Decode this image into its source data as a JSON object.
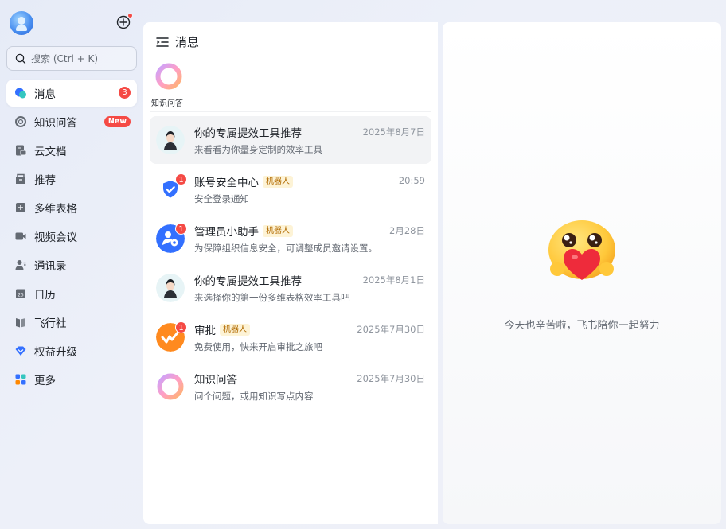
{
  "sidebar": {
    "search_placeholder": "搜索 (Ctrl + K)",
    "items": [
      {
        "label": "消息",
        "icon": "chat-bubble-icon",
        "badge": "3",
        "active": true
      },
      {
        "label": "知识问答",
        "icon": "knowledge-qa-icon",
        "new_badge": "New"
      },
      {
        "label": "云文档",
        "icon": "cloud-docs-icon"
      },
      {
        "label": "推荐",
        "icon": "recommend-icon"
      },
      {
        "label": "多维表格",
        "icon": "multi-table-icon"
      },
      {
        "label": "视频会议",
        "icon": "video-meeting-icon"
      },
      {
        "label": "通讯录",
        "icon": "contacts-icon"
      },
      {
        "label": "日历",
        "icon": "calendar-icon"
      },
      {
        "label": "飞行社",
        "icon": "flight-club-icon"
      },
      {
        "label": "权益升级",
        "icon": "upgrade-diamond-icon"
      },
      {
        "label": "更多",
        "icon": "more-apps-icon"
      }
    ]
  },
  "list": {
    "title": "消息",
    "pinned_label": "知识问答",
    "conversations": [
      {
        "name": "你的专属提效工具推荐",
        "time": "2025年8月7日",
        "preview": "来看看为你量身定制的效率工具",
        "active": true
      },
      {
        "name": "账号安全中心",
        "tag": "机器人",
        "time": "20:59",
        "preview": "安全登录通知",
        "unread": "1"
      },
      {
        "name": "管理员小助手",
        "tag": "机器人",
        "time": "2月28日",
        "preview": "为保障组织信息安全，可调整成员邀请设置。",
        "unread": "1"
      },
      {
        "name": "你的专属提效工具推荐",
        "time": "2025年8月1日",
        "preview": "来选择你的第一份多维表格效率工具吧"
      },
      {
        "name": "审批",
        "tag": "机器人",
        "time": "2025年7月30日",
        "preview": "免费使用，快来开启审批之旅吧",
        "unread": "1"
      },
      {
        "name": "知识问答",
        "time": "2025年7月30日",
        "preview": "问个问题，或用知识写点内容"
      }
    ]
  },
  "empty_state": {
    "message": "今天也辛苦啦，飞书陪你一起努力"
  },
  "colors": {
    "badge_red": "#f54a45",
    "accent_blue": "#3370ff",
    "bot_tag_bg": "#fdf3d6"
  }
}
